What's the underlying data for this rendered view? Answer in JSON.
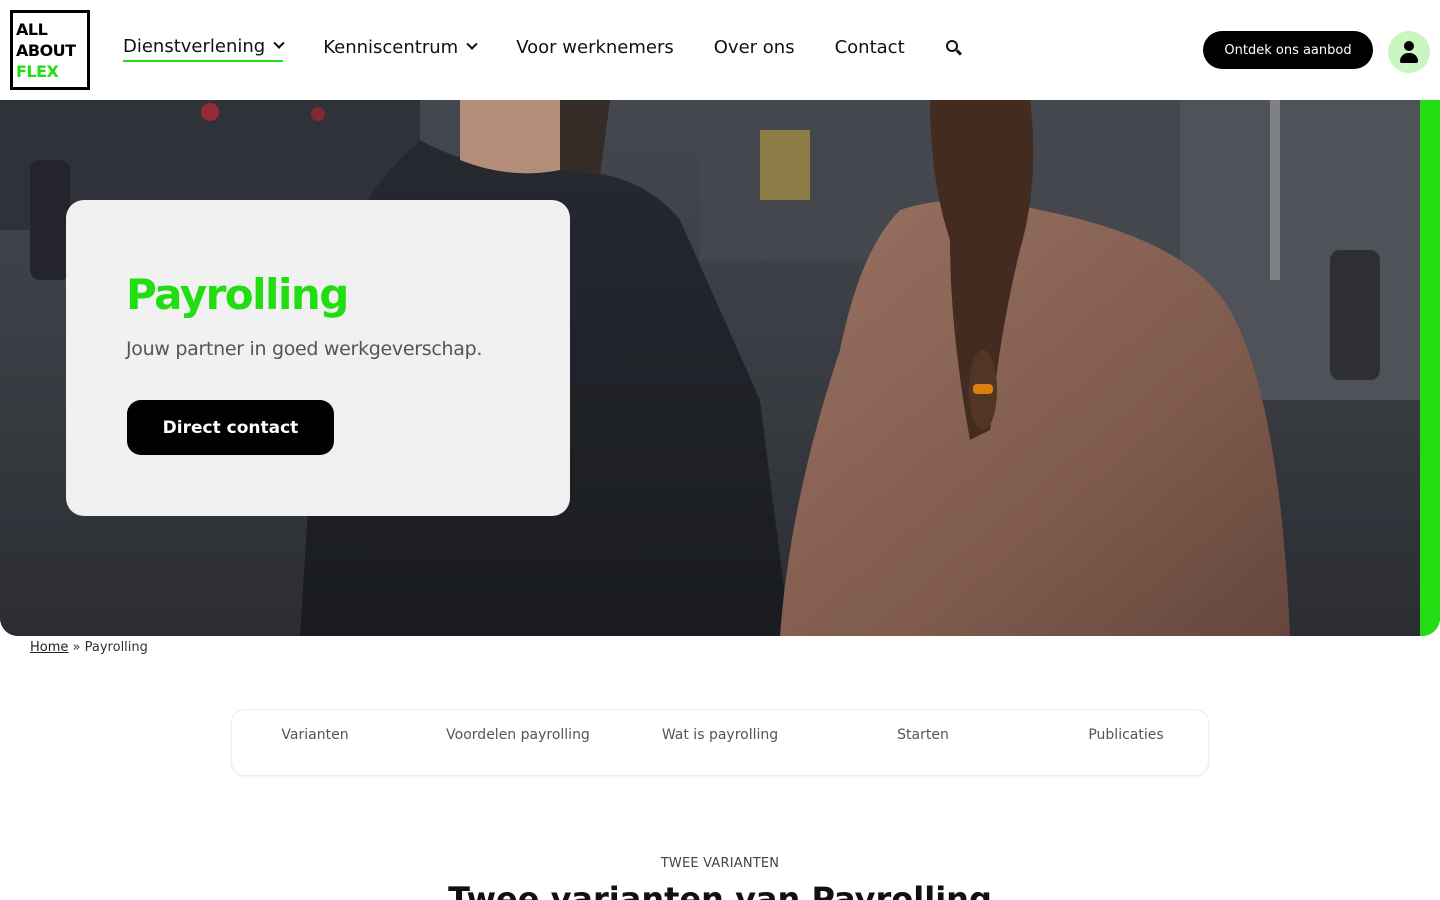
{
  "logo": {
    "line1": "ALL",
    "line2": "ABOUT",
    "line3": "FLEX"
  },
  "nav": {
    "items": [
      {
        "label": "Dienstverlening",
        "dropdown": true,
        "active": true
      },
      {
        "label": "Kenniscentrum",
        "dropdown": true,
        "active": false
      },
      {
        "label": "Voor werknemers",
        "dropdown": false,
        "active": false
      },
      {
        "label": "Over ons",
        "dropdown": false,
        "active": false
      },
      {
        "label": "Contact",
        "dropdown": false,
        "active": false
      }
    ],
    "search_icon": "search-icon"
  },
  "header": {
    "cta_label": "Ontdek ons aanbod",
    "user_icon": "user-icon"
  },
  "hero": {
    "title": "Payrolling",
    "subtitle": "Jouw partner in goed werkgeverschap.",
    "button_label": "Direct contact"
  },
  "breadcrumb": {
    "home": "Home",
    "separator": "»",
    "current": "Payrolling"
  },
  "tabs": [
    {
      "label": "Varianten"
    },
    {
      "label": "Voordelen payrolling"
    },
    {
      "label": "Wat is payrolling"
    },
    {
      "label": "Starten"
    },
    {
      "label": "Publicaties"
    }
  ],
  "section": {
    "eyebrow": "TWEE VARIANTEN",
    "title": "Twee varianten van Payrolling"
  },
  "colors": {
    "accent": "#22dd11",
    "dark": "#000000",
    "user_bg": "#c9f5c1"
  }
}
